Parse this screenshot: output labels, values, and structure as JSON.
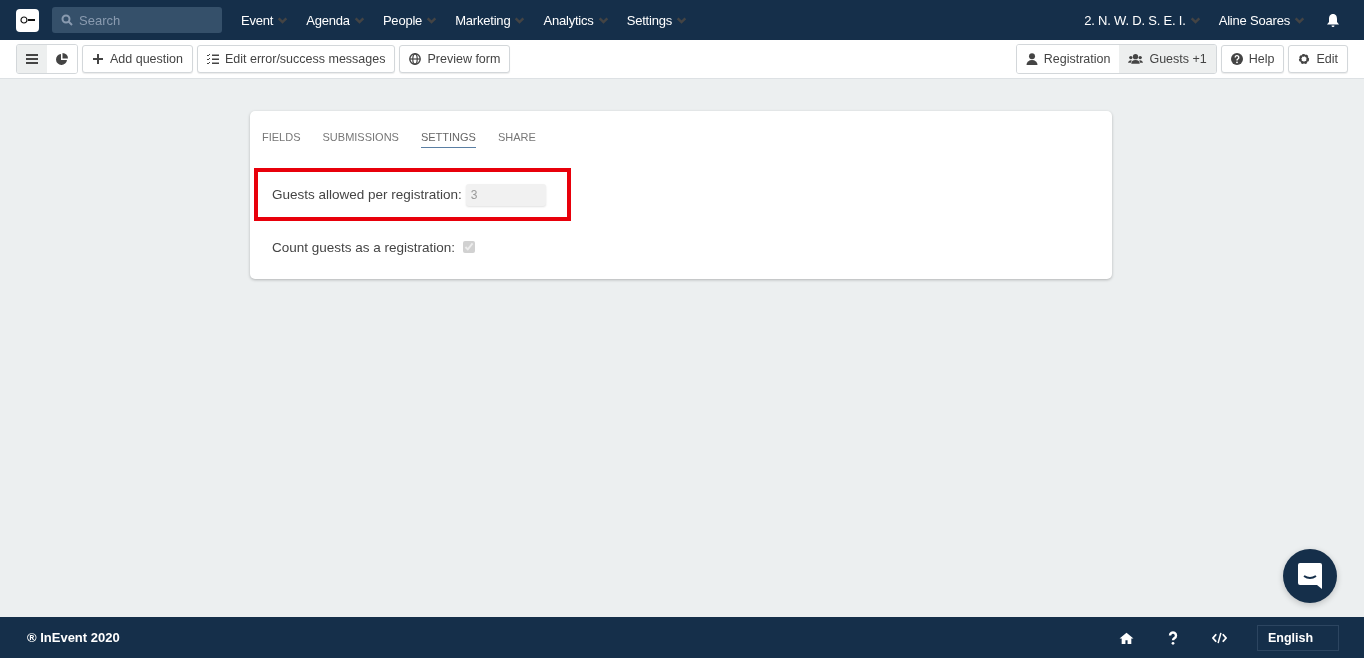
{
  "topbar": {
    "search": {
      "placeholder": "Search"
    },
    "menus": [
      {
        "label": "Event"
      },
      {
        "label": "Agenda"
      },
      {
        "label": "People"
      },
      {
        "label": "Marketing"
      },
      {
        "label": "Analytics"
      },
      {
        "label": "Settings"
      }
    ],
    "event_menu": "2. N. W. D. S. E. I.",
    "user_menu": "Aline Soares"
  },
  "toolbar": {
    "views": [
      {
        "kind": "list",
        "selected": true
      },
      {
        "kind": "chart",
        "selected": false
      }
    ],
    "actions": [
      {
        "kind": "plus",
        "label": "Add question"
      },
      {
        "kind": "checklist",
        "label": "Edit error/success messages"
      },
      {
        "kind": "globe",
        "label": "Preview form"
      }
    ],
    "modes": [
      {
        "kind": "user",
        "label": "Registration",
        "selected": false
      },
      {
        "kind": "users",
        "label": "Guests +1",
        "selected": true
      }
    ],
    "right_actions": [
      {
        "kind": "help",
        "label": "Help"
      },
      {
        "kind": "gear",
        "label": "Edit"
      }
    ]
  },
  "card": {
    "tabs": [
      {
        "label": "FIELDS",
        "selected": false
      },
      {
        "label": "SUBMISSIONS",
        "selected": false
      },
      {
        "label": "SETTINGS",
        "selected": true
      },
      {
        "label": "SHARE",
        "selected": false
      }
    ],
    "settings": [
      {
        "kind": "number",
        "label": "Guests allowed per registration:",
        "value": "3",
        "disabled": true,
        "highlighted": true
      },
      {
        "kind": "checkbox",
        "label": "Count guests as a registration:",
        "checked": true,
        "disabled": true,
        "highlighted": false
      }
    ]
  },
  "footer": {
    "copyright": "® InEvent 2020",
    "language": "English"
  }
}
